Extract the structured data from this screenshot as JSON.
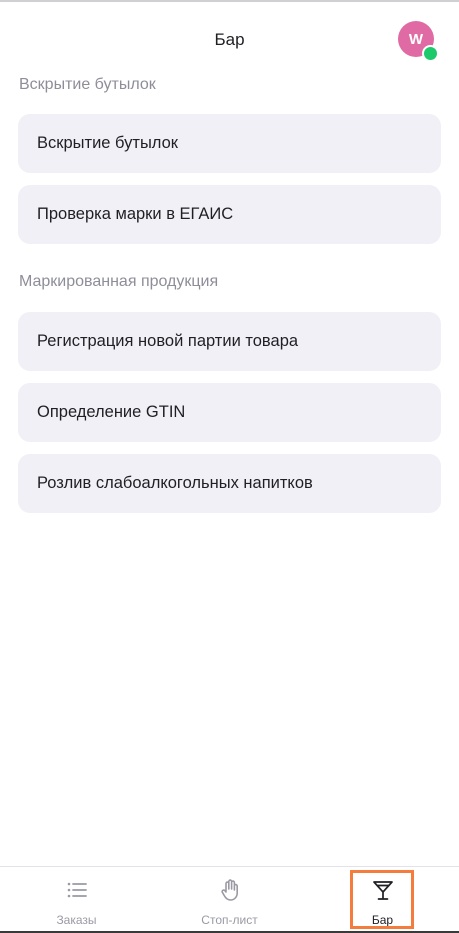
{
  "header": {
    "title": "Бар",
    "avatar_initial": "W"
  },
  "sections": [
    {
      "title": "Вскрытие бутылок",
      "items": [
        {
          "label": "Вскрытие бутылок"
        },
        {
          "label": "Проверка марки в ЕГАИС"
        }
      ]
    },
    {
      "title": "Маркированная продукция",
      "items": [
        {
          "label": "Регистрация новой партии товара"
        },
        {
          "label": "Определение GTIN"
        },
        {
          "label": "Розлив слабоалкогольных напитков"
        }
      ]
    }
  ],
  "bottom_nav": {
    "tabs": [
      {
        "label": "Заказы",
        "icon": "list-icon"
      },
      {
        "label": "Стоп-лист",
        "icon": "hand-stop-icon"
      },
      {
        "label": "Бар",
        "icon": "cocktail-glass-icon",
        "active": true
      }
    ]
  },
  "colors": {
    "card_background": "#f0f0f6",
    "avatar_background": "#e06aa3",
    "online_status": "#1ec96b",
    "active_highlight": "#f47c3c",
    "section_title": "#8e8e99"
  }
}
